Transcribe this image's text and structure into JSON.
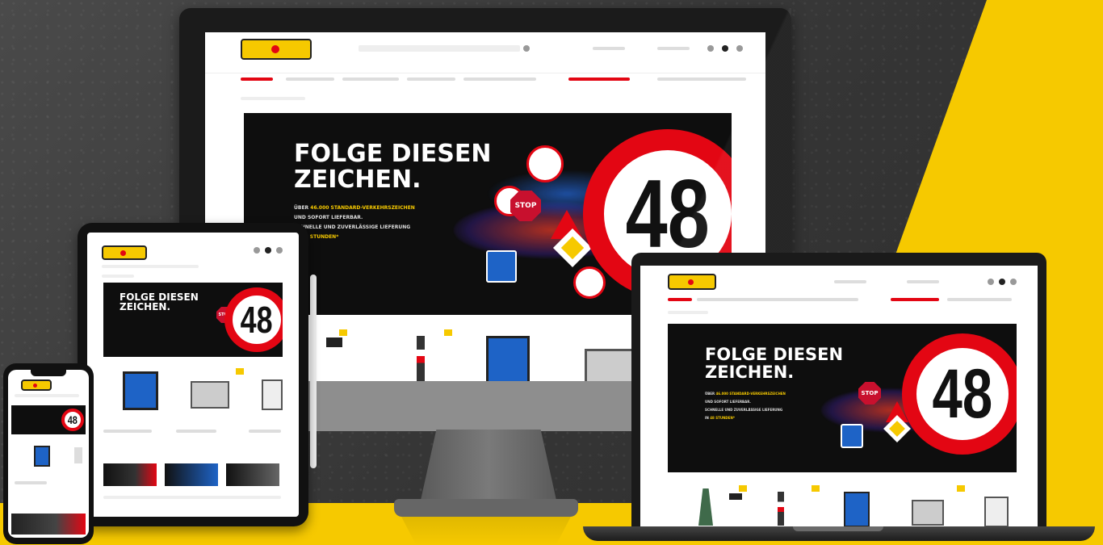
{
  "hero": {
    "headline_line1": "FOLGE DIESEN",
    "headline_line2": "ZEICHEN.",
    "sub_line1_prefix": "ÜBER",
    "sub_line1_highlight": "46.000 STANDARD-VERKEHRSZEICHEN",
    "sub_line2": "UND SOFORT LIEFERBAR.",
    "sub_line3": "SCHNELLE UND ZUVERLÄSSIGE LIEFERUNG",
    "sub_line4_prefix": "IN",
    "sub_line4_highlight": "48 STUNDEN*",
    "speed_sign_number": "48",
    "stop_sign_text": "STOP"
  },
  "colors": {
    "brand_yellow": "#f6c900",
    "sign_red": "#e30613",
    "hero_black": "#0e0e0e"
  },
  "icons": [
    "search-icon",
    "user-icon",
    "cart-icon",
    "menu-icon"
  ]
}
